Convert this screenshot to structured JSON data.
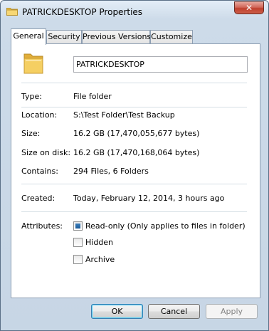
{
  "window": {
    "title": "PATRICKDESKTOP Properties",
    "close_label": "✕"
  },
  "tabs": [
    {
      "label": "General",
      "active": true
    },
    {
      "label": "Security",
      "active": false
    },
    {
      "label": "Previous Versions",
      "active": false
    },
    {
      "label": "Customize",
      "active": false
    }
  ],
  "general": {
    "folder_name": "PATRICKDESKTOP",
    "type_label": "Type:",
    "type_value": "File folder",
    "location_label": "Location:",
    "location_value": "S:\\Test Folder\\Test Backup",
    "size_label": "Size:",
    "size_value": "16.2 GB (17,470,055,677 bytes)",
    "size_on_disk_label": "Size on disk:",
    "size_on_disk_value": "16.2 GB (17,470,168,064 bytes)",
    "contains_label": "Contains:",
    "contains_value": "294 Files, 6 Folders",
    "created_label": "Created:",
    "created_value": "Today, February 12, 2014, 3 hours ago",
    "attributes_label": "Attributes:",
    "attributes": [
      {
        "label": "Read-only (Only applies to files in folder)",
        "state": "indeterminate"
      },
      {
        "label": "Hidden",
        "state": "unchecked"
      },
      {
        "label": "Archive",
        "state": "unchecked"
      }
    ]
  },
  "buttons": {
    "ok": "OK",
    "cancel": "Cancel",
    "apply": "Apply"
  },
  "colors": {
    "folder": "#f0c44c",
    "accent": "#3c7fb1",
    "close": "#c7402e"
  }
}
